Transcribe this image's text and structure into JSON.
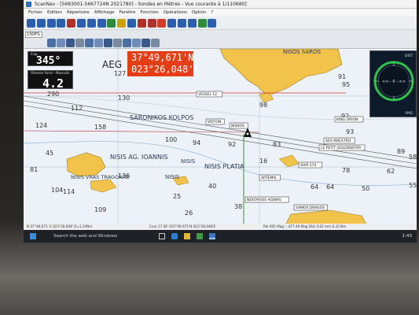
{
  "window": {
    "title": "ScanNav - [5683001-5667724N 2021780] - Sondes en Mètres - Vue courante à 1/110680]"
  },
  "menu": [
    "Fichier",
    "Edition",
    "Répertoire",
    "Affichage",
    "Fenêtre",
    "Fonction",
    "Opérations",
    "Option",
    "?"
  ],
  "toolbar": {
    "zoom_value": "130P%",
    "buttons": [
      {
        "icon": "pointer-icon",
        "color": "#2b5fae"
      },
      {
        "icon": "crosshair-icon",
        "color": "#2b5fae"
      },
      {
        "icon": "route-icon",
        "color": "#2b5fae"
      },
      {
        "icon": "track-icon",
        "color": "#2b5fae"
      },
      {
        "icon": "waypoint-icon",
        "color": "#b0302a"
      },
      {
        "icon": "measure-icon",
        "color": "#2b5fae"
      },
      {
        "icon": "text-icon",
        "color": "#2b5fae"
      },
      {
        "icon": "layer-icon",
        "color": "#2b5fae"
      },
      {
        "icon": "chart-icon",
        "color": "#2e8b3a"
      },
      {
        "icon": "alarm-icon",
        "color": "#c9a300"
      },
      {
        "icon": "info-icon",
        "color": "#2b5fae"
      },
      {
        "icon": "target-icon",
        "color": "#b0302a"
      },
      {
        "icon": "flag-icon",
        "color": "#b0302a"
      },
      {
        "icon": "lifebuoy-icon",
        "color": "#d13b2a"
      },
      {
        "icon": "tide-icon",
        "color": "#2b5fae"
      },
      {
        "icon": "grid-icon",
        "color": "#2b5fae"
      },
      {
        "icon": "boat-icon",
        "color": "#2b5fae"
      },
      {
        "icon": "map-icon",
        "color": "#2e8b3a"
      },
      {
        "icon": "settings-icon",
        "color": "#2b5fae"
      }
    ]
  },
  "nav": {
    "heading_label": "Cap",
    "heading_value": "345°",
    "speed_label": "Vitesse fond - Noeuds",
    "speed_value": "4.2",
    "lat": "37°49,671'N",
    "lon": "023°26,048'E",
    "compass_top_label": "DIST",
    "compass_bottom_label": "VMG",
    "compass_center": "<<-- 0 -->>"
  },
  "chart_labels": {
    "area_aeg": "AEG",
    "gulf": "SARONIKOS KOLPOS",
    "nisis_st_ioannis": "NISIS AG. IOANNIS",
    "nisis_plat": "NISIS PLATIA",
    "nisis": "NISIS",
    "nisis2": "NISIS",
    "nis_west": "NISIS VRAS TRAGONISI",
    "nisos_north": "NISOS SAROS",
    "depths": [
      "127",
      "130",
      "112",
      "158",
      "290",
      "100",
      "94",
      "92",
      "83",
      "95",
      "91",
      "89",
      "93",
      "104",
      "109",
      "124",
      "136",
      "81",
      "40",
      "25",
      "26",
      "38",
      "64",
      "64",
      "50",
      "55",
      "62",
      "58",
      "78",
      "98",
      "45",
      "16",
      "92",
      "114"
    ],
    "boxes": [
      "NEKTARIOS AGINAS",
      "SAMOS DRAGOS",
      "KING ORION",
      "SEA MAESTRO",
      "LE PETIT GOLDENSTAR",
      "SHIP 274",
      "VRITON",
      "NISSOS",
      "ARTEMIS",
      "VESSEL 12"
    ]
  },
  "statusbar": {
    "left": "N 37°49,671' E 023°26,048' D=1.24Nm",
    "mid": "Curs 17.46' 037°49.671'N 023°26,048'E",
    "right": "Rel 065 Mag -- 477.49 Mag  Dist 4.62 mm  6.33 Nm"
  },
  "taskbar": {
    "search": "Search the web and Windows",
    "time": "1:43"
  }
}
